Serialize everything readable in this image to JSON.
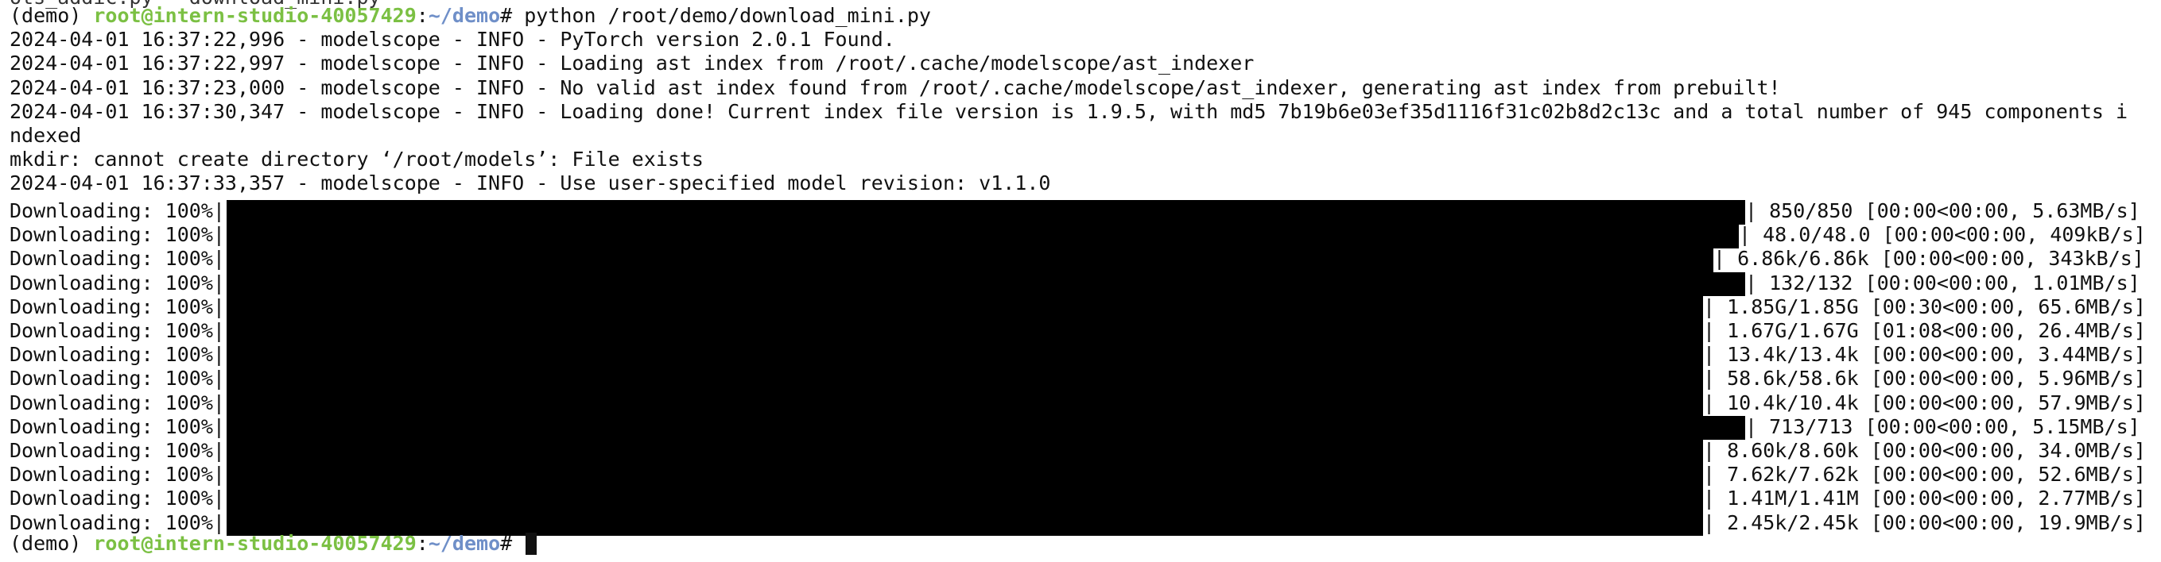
{
  "terminal": {
    "partial_top_line": "ots_addic.py   download_mini.py",
    "prompt": {
      "env": "(demo) ",
      "user_host": "root@intern-studio-40057429",
      "colon": ":",
      "path": "~/demo",
      "symbol": "# "
    },
    "command": "python /root/demo/download_mini.py",
    "log_lines": [
      "2024-04-01 16:37:22,996 - modelscope - INFO - PyTorch version 2.0.1 Found.",
      "2024-04-01 16:37:22,997 - modelscope - INFO - Loading ast index from /root/.cache/modelscope/ast_indexer",
      "2024-04-01 16:37:23,000 - modelscope - INFO - No valid ast index found from /root/.cache/modelscope/ast_indexer, generating ast index from prebuilt!",
      "2024-04-01 16:37:30,347 - modelscope - INFO - Loading done! Current index file version is 1.9.5, with md5 7b19b6e03ef35d1116f31c02b8d2c13c and a total number of 945 components i",
      "ndexed",
      "mkdir: cannot create directory ‘/root/models’: File exists",
      "2024-04-01 16:37:33,357 - modelscope - INFO - Use user-specified model revision: v1.1.0"
    ],
    "download_label": "Downloading: 100%|",
    "downloads": [
      {
        "progress": 1.0,
        "stats": "| 850/850 [00:00<00:00, 5.63MB/s]"
      },
      {
        "progress": 1.0,
        "stats": "| 48.0/48.0 [00:00<00:00, 409kB/s]"
      },
      {
        "progress": 1.0,
        "stats": "| 6.86k/6.86k [00:00<00:00, 343kB/s]"
      },
      {
        "progress": 1.0,
        "stats": "| 132/132 [00:00<00:00, 1.01MB/s]"
      },
      {
        "progress": 1.0,
        "stats": "| 1.85G/1.85G [00:30<00:00, 65.6MB/s]"
      },
      {
        "progress": 1.0,
        "stats": "| 1.67G/1.67G [01:08<00:00, 26.4MB/s]"
      },
      {
        "progress": 1.0,
        "stats": "| 13.4k/13.4k [00:00<00:00, 3.44MB/s]"
      },
      {
        "progress": 1.0,
        "stats": "| 58.6k/58.6k [00:00<00:00, 5.96MB/s]"
      },
      {
        "progress": 1.0,
        "stats": "| 10.4k/10.4k [00:00<00:00, 57.9MB/s]"
      },
      {
        "progress": 1.0,
        "stats": "| 713/713 [00:00<00:00, 5.15MB/s]"
      },
      {
        "progress": 1.0,
        "stats": "| 8.60k/8.60k [00:00<00:00, 34.0MB/s]"
      },
      {
        "progress": 1.0,
        "stats": "| 7.62k/7.62k [00:00<00:00, 52.6MB/s]"
      },
      {
        "progress": 1.0,
        "stats": "| 1.41M/1.41M [00:00<00:00, 2.77MB/s]"
      },
      {
        "progress": 1.0,
        "stats": "| 2.45k/2.45k [00:00<00:00, 19.9MB/s]"
      }
    ],
    "colors": {
      "user_host": "#7bc043",
      "path": "#6f8fc8",
      "text": "#111111",
      "bar": "#000000",
      "background": "#ffffff"
    }
  }
}
